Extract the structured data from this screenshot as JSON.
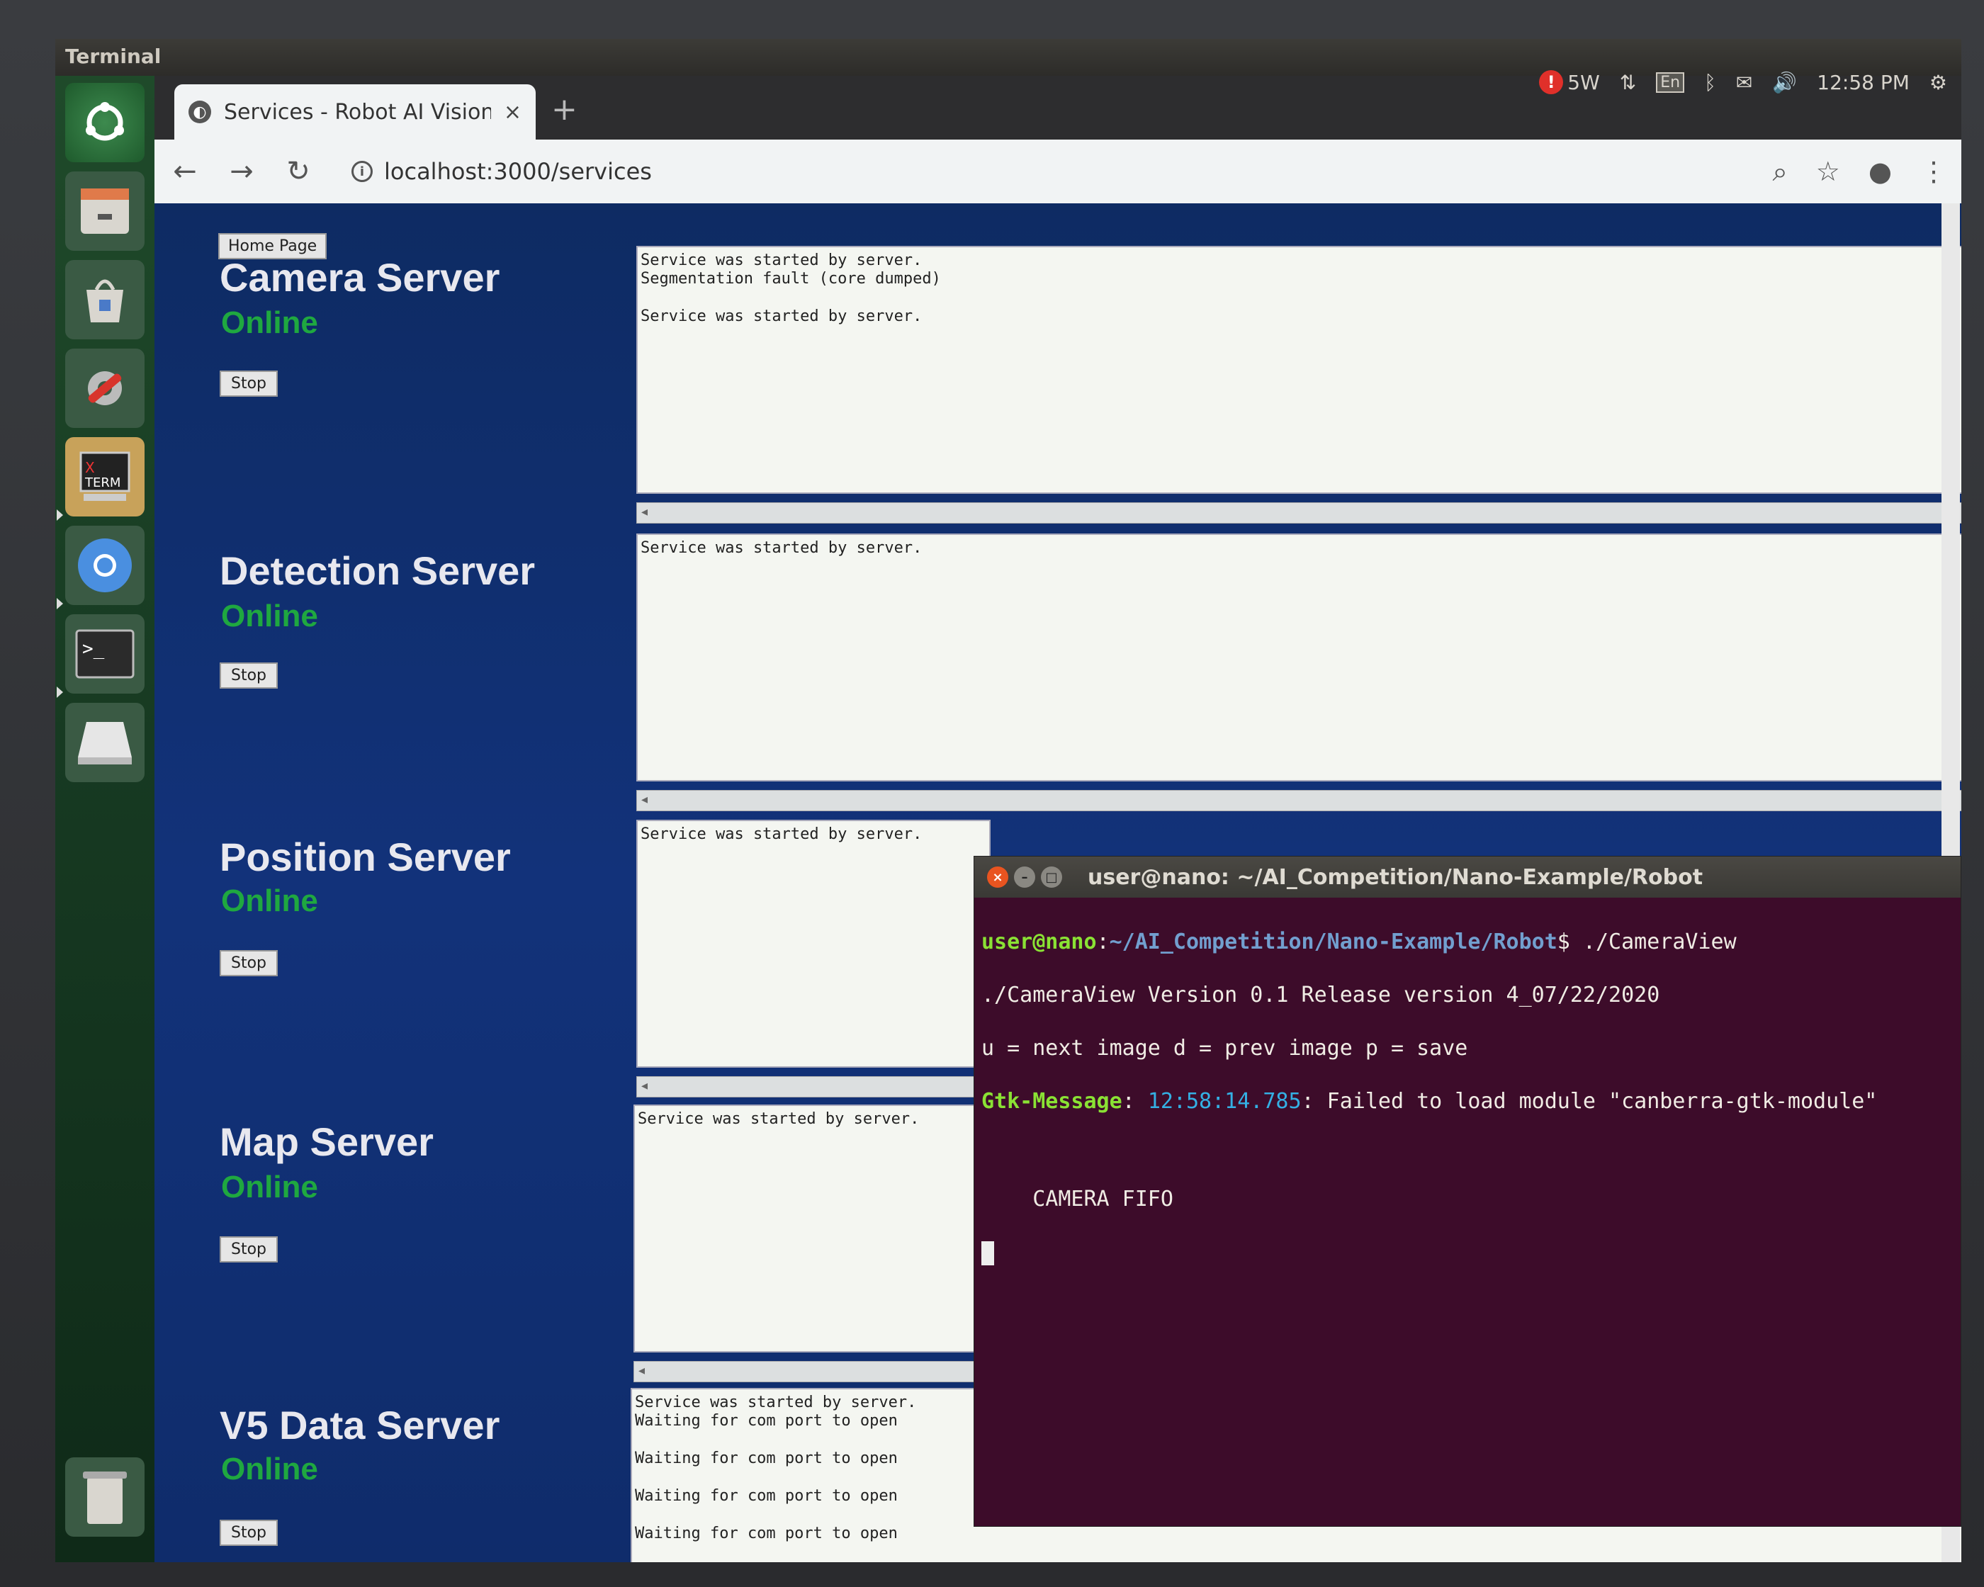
{
  "panel": {
    "title": "Terminal",
    "indicators": {
      "power": "5W",
      "keyboard": "En",
      "time": "12:58 PM"
    }
  },
  "launcher": {
    "items": [
      "dash-home",
      "file-manager",
      "software-center",
      "system-settings",
      "xterm",
      "chromium",
      "terminal",
      "drive"
    ],
    "trash": "trash"
  },
  "browser": {
    "tab_title": "Services - Robot AI Vision",
    "tab_close": "×",
    "new_tab": "+",
    "url": "localhost:3000/services"
  },
  "page": {
    "home_button": "Home Page",
    "services": [
      {
        "name": "Camera Server",
        "status": "Online",
        "stop": "Stop",
        "log": "Service was started by server.\nSegmentation fault (core dumped)\n\nService was started by server."
      },
      {
        "name": "Detection Server",
        "status": "Online",
        "stop": "Stop",
        "log": "Service was started by server."
      },
      {
        "name": "Position Server",
        "status": "Online",
        "stop": "Stop",
        "log": "Service was started by server."
      },
      {
        "name": "Map Server",
        "status": "Online",
        "stop": "Stop",
        "log": "Service was started by server."
      },
      {
        "name": "V5 Data Server",
        "status": "Online",
        "stop": "Stop",
        "log": "Service was started by server.\nWaiting for com port to open\n\nWaiting for com port to open\n\nWaiting for com port to open\n\nWaiting for com port to open"
      }
    ]
  },
  "terminal": {
    "title": "user@nano: ~/AI_Competition/Nano-Example/Robot",
    "prompt_user": "user@nano",
    "prompt_sep": ":",
    "prompt_path": "~/AI_Competition/Nano-Example/Robot",
    "prompt_cmd": "$ ./CameraView",
    "line1": "./CameraView Version 0.1 Release version 4_07/22/2020",
    "line2": "u = next image d = prev image p = save",
    "gtk_label": "Gtk-Message",
    "gtk_sep": ": ",
    "gtk_time": "12:58:14.785",
    "gtk_msg": ": Failed to load module \"canberra-gtk-module\"",
    "line4": "    CAMERA FIFO"
  }
}
